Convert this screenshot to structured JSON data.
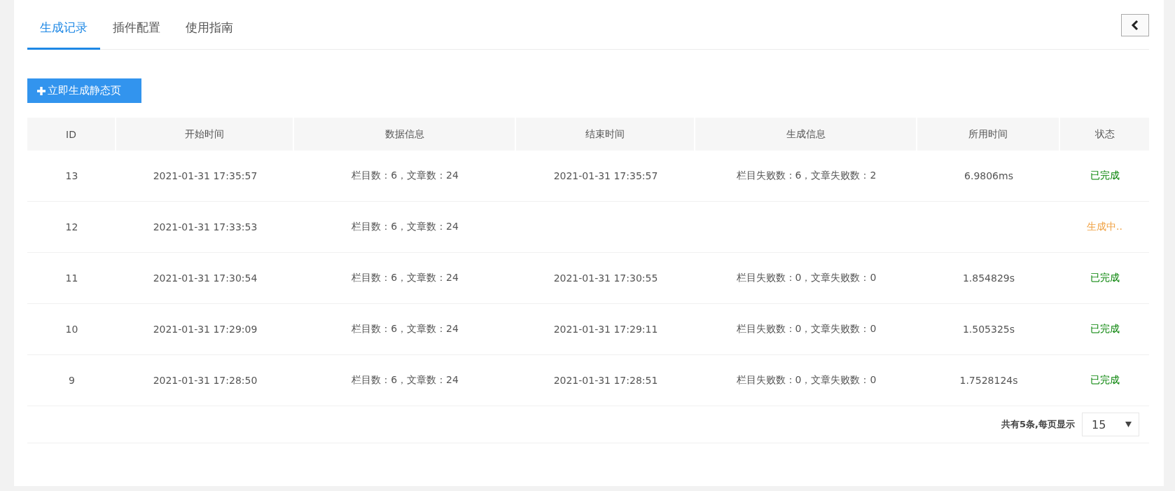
{
  "tabs": [
    {
      "label": "生成记录",
      "selected": true
    },
    {
      "label": "插件配置",
      "selected": false
    },
    {
      "label": "使用指南",
      "selected": false
    }
  ],
  "generate_button": {
    "label": "立即生成静态页"
  },
  "table": {
    "columns": [
      "ID",
      "开始时间",
      "数据信息",
      "结束时间",
      "生成信息",
      "所用时间",
      "状态"
    ],
    "rows": [
      {
        "id": "13",
        "start": "2021-01-31 17:35:57",
        "data": "栏目数：6，文章数：24",
        "end": "2021-01-31 17:35:57",
        "result": "栏目失败数：6，文章失败数：2",
        "duration": "6.9806ms",
        "status": "已完成",
        "color": "#008000"
      },
      {
        "id": "12",
        "start": "2021-01-31 17:33:53",
        "data": "栏目数：6，文章数：24",
        "status": "生成中..",
        "color": "#f0a040"
      },
      {
        "id": "11",
        "start": "2021-01-31 17:30:54",
        "data": "栏目数：6，文章数：24",
        "end": "2021-01-31 17:30:55",
        "result": "栏目失败数：0，文章失败数：0",
        "duration": "1.854829s",
        "status": "已完成",
        "color": "#008000"
      },
      {
        "id": "10",
        "start": "2021-01-31 17:29:09",
        "data": "栏目数：6，文章数：24",
        "end": "2021-01-31 17:29:11",
        "result": "栏目失败数：0，文章失败数：0",
        "duration": "1.505325s",
        "status": "已完成",
        "color": "#008000"
      },
      {
        "id": "9",
        "start": "2021-01-31 17:28:50",
        "data": "栏目数：6，文章数：24",
        "end": "2021-01-31 17:28:51",
        "result": "栏目失败数：0，文章失败数：0",
        "duration": "1.7528124s",
        "status": "已完成",
        "color": "#008000"
      }
    ]
  },
  "pagination": {
    "summary": "共有5条,每页显示",
    "page_size": "15"
  }
}
